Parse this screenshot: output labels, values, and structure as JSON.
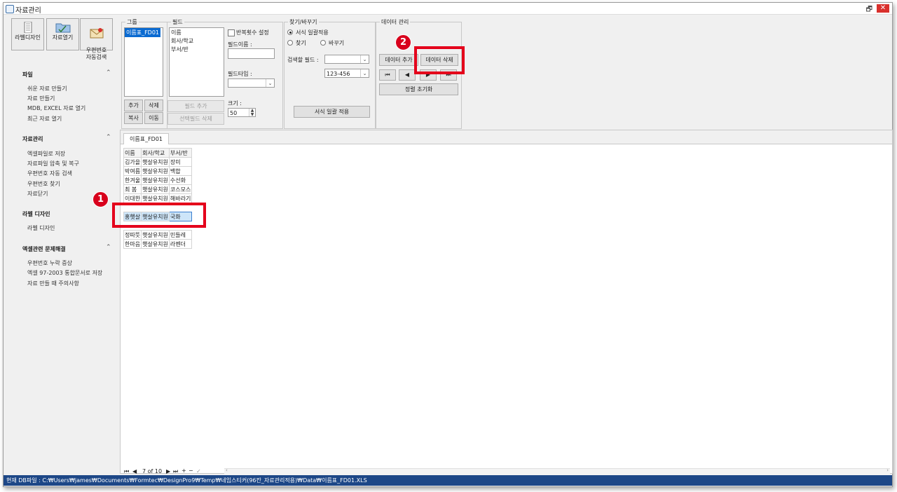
{
  "window": {
    "title": "자료관리"
  },
  "sidebar": {
    "top_buttons": [
      {
        "label": "라벨디자인"
      },
      {
        "label": "자료열기"
      },
      {
        "label": "우편번호\n자동검색"
      }
    ],
    "sections": [
      {
        "header": "파일",
        "items": [
          "쉬운 자료 만들기",
          "자료 만들기",
          "MDB, EXCEL 자료 열기",
          "최근 자료 열기"
        ]
      },
      {
        "header": "자료관리",
        "items": [
          "엑셀파일로 저장",
          "자료파일 압축 및 복구",
          "우편번호 자동 검색",
          "우편번호 찾기",
          "자료닫기"
        ]
      },
      {
        "header": "라벨 디자인",
        "items": [
          "라벨 디자인"
        ]
      },
      {
        "header": "엑셀관련 문제해결",
        "items": [
          "우편번호 누락 증상",
          "엑셀 97-2003 통합문서로 저장",
          "자료 만들 때 주의사항"
        ]
      }
    ]
  },
  "group_panel": {
    "legend": "그룹",
    "list": [
      "이름표_FD01"
    ],
    "add": "추가",
    "delete": "삭제",
    "copy": "복사",
    "move": "이동"
  },
  "field_panel": {
    "legend": "필드",
    "list": [
      "이름",
      "회사/학교",
      "부서/반"
    ],
    "repeat_label": "반복횟수 설정",
    "field_name_label": "필드이름 :",
    "field_type_label": "필드타입 :",
    "size_label": "크기 :",
    "size_value": "50",
    "add_field": "필드 추가",
    "delete_field": "선택필드 삭제"
  },
  "find_panel": {
    "legend": "찾기/바꾸기",
    "apply_all": "서식 일괄적용",
    "find": "찾기",
    "replace": "바꾸기",
    "search_field_label": "검색할 필드 :",
    "format_value": "123-456",
    "apply_button": "서식 일괄 적용"
  },
  "data_panel": {
    "legend": "데이터 관리",
    "add": "데이터 추가",
    "delete": "데이터 삭제",
    "reset": "정렬 초기화"
  },
  "tab": {
    "label": "이름표_FD01"
  },
  "grid": {
    "headers": [
      "이름",
      "회사/학교",
      "부서/반"
    ],
    "rows": [
      [
        "김가을",
        "햇살유치원",
        "장미"
      ],
      [
        "박여름",
        "햇살유치원",
        "백합"
      ],
      [
        "한겨울",
        "햇살유치원",
        "수선화"
      ],
      [
        "최 봄",
        "햇살유치원",
        "코스모스"
      ],
      [
        "이대한",
        "햇살유치원",
        "해바라기"
      ],
      [
        "홍햇살",
        "햇살유치원",
        "국화"
      ],
      [
        "정따뜻",
        "햇살유치원",
        "민들레"
      ],
      [
        "한마음",
        "햇살유치원",
        "라벤더"
      ]
    ],
    "selected_row": 5
  },
  "pager": {
    "text": "7 of 10"
  },
  "status": {
    "path": "현재 DB파일 : C:₩Users₩james₩Documents₩Formtec₩DesignPro9₩Temp₩네임스티커(96칸_자료관리적용)₩Data₩이름표_FD01.XLS"
  },
  "callouts": {
    "one": "1",
    "two": "2"
  }
}
